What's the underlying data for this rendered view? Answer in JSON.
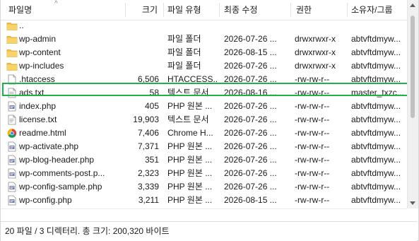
{
  "header": {
    "name": "파일명",
    "size": "크기",
    "type": "파일 유형",
    "modified": "최종 수정",
    "permissions": "권한",
    "owner": "소유자/그룹",
    "sort_glyph": "^"
  },
  "files": [
    {
      "name": "..",
      "icon": "folder-icon",
      "size": "",
      "type": "",
      "date": "",
      "perm": "",
      "owner": ""
    },
    {
      "name": "wp-admin",
      "icon": "folder-icon",
      "size": "",
      "type": "파일 폴더",
      "date": "2026-07-26 ...",
      "perm": "drwxrwxr-x",
      "owner": "abtvftdmyw..."
    },
    {
      "name": "wp-content",
      "icon": "folder-icon",
      "size": "",
      "type": "파일 폴더",
      "date": "2026-08-15 ...",
      "perm": "drwxrwxr-x",
      "owner": "abtvftdmyw..."
    },
    {
      "name": "wp-includes",
      "icon": "folder-icon",
      "size": "",
      "type": "파일 폴더",
      "date": "2026-07-26 ...",
      "perm": "drwxrwxr-x",
      "owner": "abtvftdmyw..."
    },
    {
      "name": ".htaccess",
      "icon": "file-icon",
      "size": "6,506",
      "type": "HTACCESS...",
      "date": "2026-07-26 ...",
      "perm": "-rw-rw-r--",
      "owner": "abtvftdmyw..."
    },
    {
      "name": "ads.txt",
      "icon": "text-file-icon",
      "size": "58",
      "type": "텍스트 문서",
      "date": "2026-08-16 ...",
      "perm": "-rw-rw-r--",
      "owner": "master_txzc..."
    },
    {
      "name": "index.php",
      "icon": "php-file-icon",
      "size": "405",
      "type": "PHP 원본 ...",
      "date": "2026-07-26 ...",
      "perm": "-rw-rw-r--",
      "owner": "abtvftdmyw..."
    },
    {
      "name": "license.txt",
      "icon": "text-file-icon",
      "size": "19,903",
      "type": "텍스트 문서",
      "date": "2026-07-26 ...",
      "perm": "-rw-rw-r--",
      "owner": "abtvftdmyw..."
    },
    {
      "name": "readme.html",
      "icon": "chrome-icon",
      "size": "7,406",
      "type": "Chrome H...",
      "date": "2026-07-26 ...",
      "perm": "-rw-rw-r--",
      "owner": "abtvftdmyw..."
    },
    {
      "name": "wp-activate.php",
      "icon": "php-file-icon",
      "size": "7,371",
      "type": "PHP 원본 ...",
      "date": "2026-07-26 ...",
      "perm": "-rw-rw-r--",
      "owner": "abtvftdmyw..."
    },
    {
      "name": "wp-blog-header.php",
      "icon": "php-file-icon",
      "size": "351",
      "type": "PHP 원본 ...",
      "date": "2026-07-26 ...",
      "perm": "-rw-rw-r--",
      "owner": "abtvftdmyw..."
    },
    {
      "name": "wp-comments-post.p...",
      "icon": "php-file-icon",
      "size": "2,323",
      "type": "PHP 원본 ...",
      "date": "2026-07-26 ...",
      "perm": "-rw-rw-r--",
      "owner": "abtvftdmyw..."
    },
    {
      "name": "wp-config-sample.php",
      "icon": "php-file-icon",
      "size": "3,339",
      "type": "PHP 원본 ...",
      "date": "2026-07-26 ...",
      "perm": "-rw-rw-r--",
      "owner": "abtvftdmyw..."
    },
    {
      "name": "wp-config.php",
      "icon": "php-file-icon",
      "size": "3,211",
      "type": "PHP 원본 ...",
      "date": "2026-08-15 ...",
      "perm": "-rw-rw-r--",
      "owner": "abtvftdmyw..."
    }
  ],
  "status": {
    "text": "20 파일 / 3 디렉터리. 총 크기: 200,320 바이트"
  },
  "colors": {
    "highlight": "#22b04b",
    "folder": "#f2c14e",
    "php": "#6d77b3"
  }
}
